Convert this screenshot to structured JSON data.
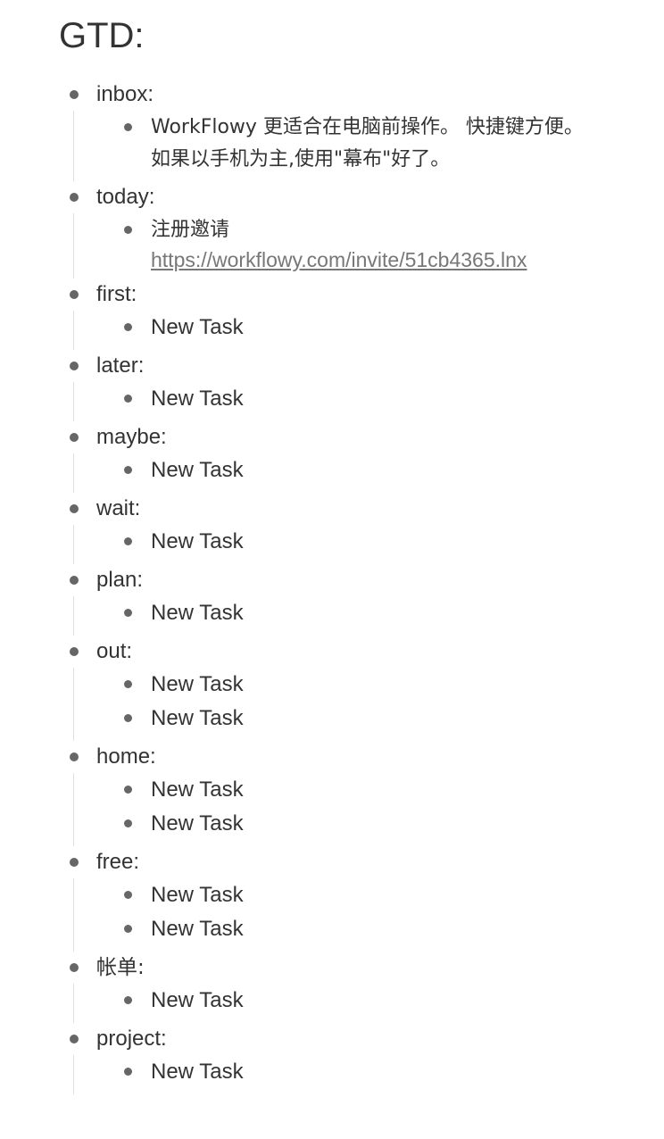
{
  "title": "GTD:",
  "colors": {
    "text": "#333333",
    "bullet": "#666666",
    "link": "#777777",
    "guide_line": "#e0e0e0"
  },
  "sections": [
    {
      "label": "inbox:",
      "children": [
        {
          "text": "WorkFlowy 更适合在电脑前操作。 快捷键方便。\n如果以手机为主,使用\"幕布\"好了。"
        }
      ]
    },
    {
      "label": "today:",
      "children": [
        {
          "text": "注册邀请",
          "link": "https://workflowy.com/invite/51cb4365.lnx"
        }
      ]
    },
    {
      "label": "first:",
      "children": [
        {
          "text": "New Task"
        }
      ]
    },
    {
      "label": "later:",
      "children": [
        {
          "text": "New Task"
        }
      ]
    },
    {
      "label": "maybe:",
      "children": [
        {
          "text": "New Task"
        }
      ]
    },
    {
      "label": "wait:",
      "children": [
        {
          "text": "New Task"
        }
      ]
    },
    {
      "label": "plan:",
      "children": [
        {
          "text": "New Task"
        }
      ]
    },
    {
      "label": "out:",
      "children": [
        {
          "text": "New Task"
        },
        {
          "text": "New Task"
        }
      ]
    },
    {
      "label": "home:",
      "children": [
        {
          "text": "New Task"
        },
        {
          "text": "New Task"
        }
      ]
    },
    {
      "label": "free:",
      "children": [
        {
          "text": "New Task"
        },
        {
          "text": "New Task"
        }
      ]
    },
    {
      "label": "帐单:",
      "children": [
        {
          "text": "New Task"
        }
      ]
    },
    {
      "label": "project:",
      "children": [
        {
          "text": "New Task"
        }
      ]
    }
  ]
}
